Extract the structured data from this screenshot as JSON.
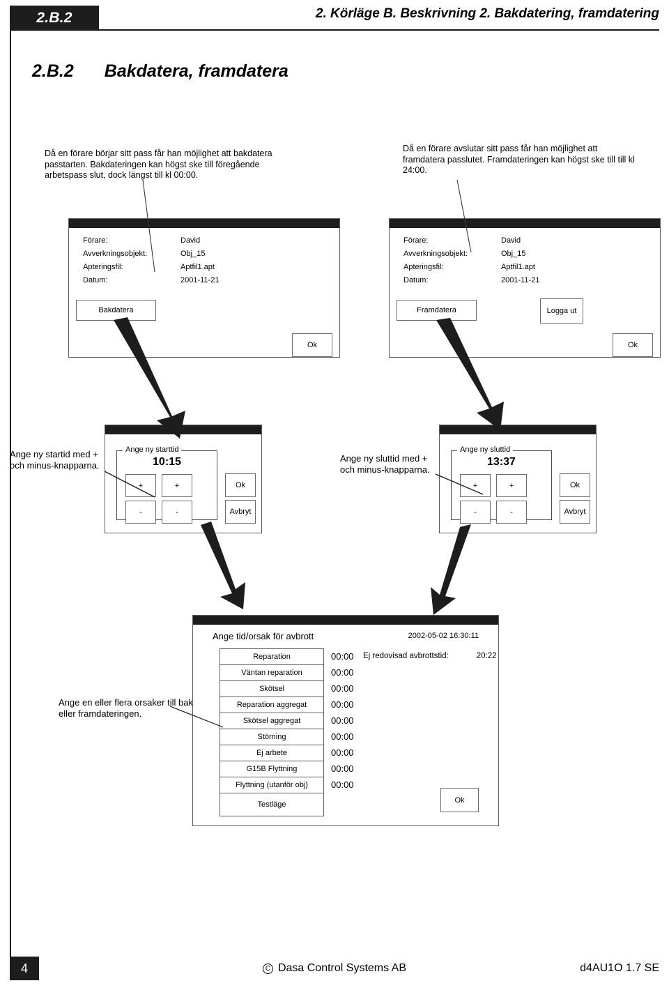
{
  "header": {
    "tab_label": "2.B.2",
    "breadcrumb": "2. Körläge  B. Beskrivning  2. Bakdatering, framdatering"
  },
  "section": {
    "number": "2.B.2",
    "title": "Bakdatera, framdatera"
  },
  "intro": {
    "left": "Då en förare börjar sitt pass får han möjlighet att bakdatera passtarten. Bakdateringen kan högst ske till föregående arbetspass slut, dock längst till kl 00:00.",
    "right": "Då en förare avslutar sitt pass får han möjlighet att framdatera passlutet. Framdateringen kan högst ske till till kl 24:00."
  },
  "login_dialog_left": {
    "fields": [
      {
        "label": "Förare:",
        "value": "David"
      },
      {
        "label": "Avverkningsobjekt:",
        "value": "Obj_15"
      },
      {
        "label": "Apteringsfil:",
        "value": "Aptfil1.apt"
      },
      {
        "label": "Datum:",
        "value": "2001-11-21"
      }
    ],
    "action_button": "Bakdatera",
    "ok_button": "Ok"
  },
  "login_dialog_right": {
    "fields": [
      {
        "label": "Förare:",
        "value": "David"
      },
      {
        "label": "Avverkningsobjekt:",
        "value": "Obj_15"
      },
      {
        "label": "Apteringsfil:",
        "value": "Aptfil1.apt"
      },
      {
        "label": "Datum:",
        "value": "2001-11-21"
      }
    ],
    "action_button": "Framdatera",
    "logout_button": "Logga ut",
    "ok_button": "Ok"
  },
  "time_dialog_start": {
    "legend": "Ange ny starttid",
    "time_value": "10:15",
    "plus_hour": "+",
    "plus_minute": "+",
    "minus_hour": "-",
    "minus_minute": "-",
    "ok_button": "Ok",
    "cancel_button": "Avbryt"
  },
  "time_dialog_end": {
    "legend": "Ange ny sluttid",
    "time_value": "13:37",
    "plus_hour": "+",
    "plus_minute": "+",
    "minus_hour": "-",
    "minus_minute": "-",
    "ok_button": "Ok",
    "cancel_button": "Avbryt"
  },
  "annotations": {
    "start_time": "Ange ny startid med + och minus-knapparna.",
    "end_time": "Ange ny sluttid med + och minus-knapparna.",
    "reasons": "Ange en eller flera orsaker till bak- eller framdateringen."
  },
  "break_dialog": {
    "title": "Ange tid/orsak för avbrott",
    "timestamp": "2002-05-02 16:30:11",
    "unreported_label": "Ej redovisad avbrottstid:",
    "unreported_value": "20:22",
    "ok_button": "Ok",
    "reasons": [
      {
        "label": "Reparation",
        "time": "00:00"
      },
      {
        "label": "Väntan reparation",
        "time": "00:00"
      },
      {
        "label": "Skötsel",
        "time": "00:00"
      },
      {
        "label": "Reparation aggregat",
        "time": "00:00"
      },
      {
        "label": "Skötsel aggregat",
        "time": "00:00"
      },
      {
        "label": "Störning",
        "time": "00:00"
      },
      {
        "label": "Ej arbete",
        "time": "00:00"
      },
      {
        "label": "G15B Flyttning",
        "time": "00:00"
      },
      {
        "label": "Flyttning (utanför obj)",
        "time": "00:00"
      },
      {
        "label": "Testläge",
        "time": ""
      }
    ]
  },
  "footer": {
    "page_number": "4",
    "copyright_symbol": "C",
    "copyright": "Dasa Control Systems AB",
    "doc_id": "d4AU1O 1.7 SE"
  },
  "colors": {
    "ink": "#1d1d1d",
    "paper": "#ffffff",
    "border": "#5b5b5b"
  }
}
